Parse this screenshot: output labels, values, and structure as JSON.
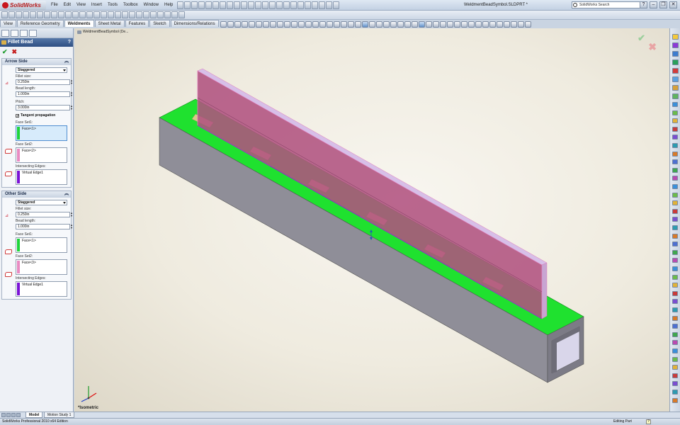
{
  "app": {
    "logo_text": "SolidWorks",
    "document_title": "WeldmentBeadSymbol.SLDPRT *",
    "search_placeholder": "SolidWorks Search"
  },
  "menu": [
    "File",
    "Edit",
    "View",
    "Insert",
    "Tools",
    "Toolbox",
    "Window",
    "Help"
  ],
  "tabs": [
    "View",
    "Reference Geometry",
    "Weldments",
    "Sheet Metal",
    "Features",
    "Sketch",
    "Dimensions/Relations"
  ],
  "active_tab": "Weldments",
  "feature_tree": {
    "part_name": "WeldmentBeadSymbol  (De..."
  },
  "property_manager": {
    "title": "Fillet Bead",
    "help": "?",
    "ok": "✔",
    "cancel": "✖",
    "arrow_side": {
      "heading": "Arrow Side",
      "type": "Staggered",
      "fillet_size_label": "Fillet size:",
      "fillet_size": "0.250in",
      "bead_length_label": "Bead length:",
      "bead_length": "1.000in",
      "pitch_label": "Pitch:",
      "pitch": "3.000in",
      "tangent_label": "Tangent propagation",
      "tangent_checked": "✓",
      "face_set1_label": "Face Set1:",
      "face_set1": "Face<1>",
      "face_set2_label": "Face Set2:",
      "face_set2": "Face<2>",
      "edges_label": "Intersecting Edges:",
      "edges": "Virtual Edge1"
    },
    "other_side": {
      "heading": "Other Side",
      "type": "Staggered",
      "fillet_size_label": "Fillet size:",
      "fillet_size": "0.250in",
      "bead_length_label": "Bead length:",
      "bead_length": "1.000in",
      "face_set1_label": "Face Set1:",
      "face_set1": "Face<1>",
      "face_set2_label": "Face Set2:",
      "face_set2": "Face<3>",
      "edges_label": "Intersecting Edges:",
      "edges": "Virtual Edge1"
    }
  },
  "graphics": {
    "view_label": "*Isometric",
    "colors": {
      "top_face": "#1fe12f",
      "side_face": "#8f8e98",
      "front_face": "#7c7b86",
      "plate": "#b0527f",
      "bead": "#d8c88a",
      "face1": "#1ed43a",
      "face2": "#e98ac2",
      "edge": "#7a12d6"
    },
    "icons": [
      "triad-icon",
      "accept-icon",
      "cancel-icon"
    ]
  },
  "bottom_tabs": [
    "Model",
    "Motion Study 1"
  ],
  "status": {
    "left": "SolidWorks Professional 2010 x64 Edition",
    "mode": "Editing Part",
    "help": "?"
  }
}
